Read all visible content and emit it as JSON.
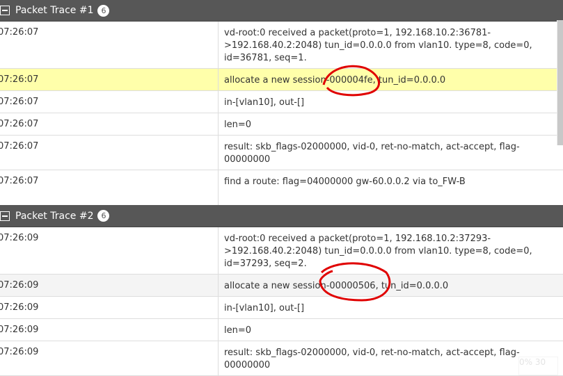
{
  "groups": [
    {
      "title": "Packet Trace #1",
      "count": "6",
      "rows": [
        {
          "time": "07:26:07",
          "msg": "vd-root:0 received a packet(proto=1, 192.168.10.2:36781->192.168.40.2:2048) tun_id=0.0.0.0 from vlan10. type=8, code=0, id=36781, seq=1."
        },
        {
          "time": "07:26:07",
          "msg": "allocate a new session-000004fe, tun_id=0.0.0.0"
        },
        {
          "time": "07:26:07",
          "msg": "in-[vlan10], out-[]"
        },
        {
          "time": "07:26:07",
          "msg": "len=0"
        },
        {
          "time": "07:26:07",
          "msg": "result: skb_flags-02000000, vid-0, ret-no-match, act-accept, flag-00000000"
        },
        {
          "time": "07:26:07",
          "msg": "find a route: flag=04000000 gw-60.0.0.2 via to_FW-B"
        }
      ]
    },
    {
      "title": "Packet Trace #2",
      "count": "6",
      "rows": [
        {
          "time": "07:26:09",
          "msg": "vd-root:0 received a packet(proto=1, 192.168.10.2:37293->192.168.40.2:2048) tun_id=0.0.0.0 from vlan10. type=8, code=0, id=37293, seq=2."
        },
        {
          "time": "07:26:09",
          "msg": "allocate a new session-00000506, tun_id=0.0.0.0"
        },
        {
          "time": "07:26:09",
          "msg": "in-[vlan10], out-[]"
        },
        {
          "time": "07:26:09",
          "msg": "len=0"
        },
        {
          "time": "07:26:09",
          "msg": "result: skb_flags-02000000, vid-0, ret-no-match, act-accept, flag-00000000"
        }
      ]
    }
  ],
  "overlay": "0% 30",
  "colors": {
    "header": "#575757",
    "highlight": "#ffffaa",
    "annotation": "#e00000"
  }
}
